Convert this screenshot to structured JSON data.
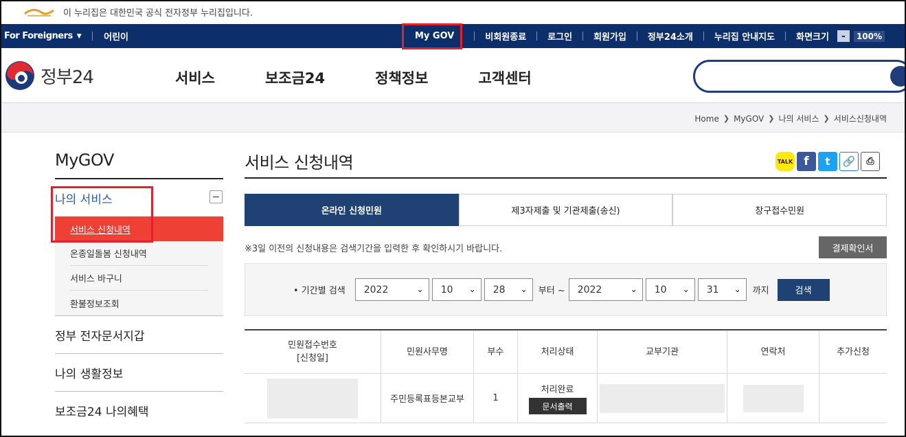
{
  "gov_banner": {
    "text": "이 누리집은 대한민국 공식 전자정부 누리집입니다."
  },
  "topbar": {
    "foreigners": "For Foreigners",
    "kids": "어린이",
    "items": [
      "My GOV",
      "비회원종료",
      "로그인",
      "회원가입",
      "정부24소개",
      "누리집 안내지도",
      "화면크기"
    ],
    "zoom_minus": "-",
    "zoom_value": "100%"
  },
  "header": {
    "logo_text": "정부24",
    "gnb": [
      "서비스",
      "보조금24",
      "정책정보",
      "고객센터"
    ],
    "search_placeholder": ""
  },
  "breadcrumb": [
    "Home",
    "MyGOV",
    "나의 서비스",
    "서비스신청내역"
  ],
  "lnb": {
    "title": "MyGOV",
    "group": "나의 서비스",
    "toggle": "−",
    "active_item": "서비스 신청내역",
    "items": [
      "온종일돌봄 신청내역",
      "서비스 바구니",
      "환불정보조회"
    ],
    "menus": [
      "정부 전자문서지갑",
      "나의 생활정보",
      "보조금24 나의혜택"
    ]
  },
  "content": {
    "title": "서비스 신청내역",
    "share": {
      "kakao": "TALK",
      "facebook": "f",
      "twitter": "t",
      "link": "🔗",
      "print": "⎙"
    },
    "tabs": [
      "온라인 신청민원",
      "제3자제출 및 기관제출(송신)",
      "창구접수민원"
    ],
    "notice": "※3일 이전의 신청내용은 검색기간을 입력한 후 확인하시기 바랍니다.",
    "receipt_button": "결제확인서",
    "search": {
      "label": "• 기간별 검색",
      "from_year": "2022",
      "from_month": "10",
      "from_day": "28",
      "from_text": "부터 ~",
      "to_year": "2022",
      "to_month": "10",
      "to_day": "31",
      "until_text": "까지",
      "button": "검색"
    },
    "table": {
      "headers": [
        "민원접수번호",
        "[신청일]",
        "민원사무명",
        "부수",
        "처리상태",
        "교부기관",
        "연락처",
        "추가신청"
      ],
      "row": {
        "service": "주민등록표등본교부",
        "copies": "1",
        "status": "처리완료",
        "print_button": "문서출력"
      }
    }
  }
}
